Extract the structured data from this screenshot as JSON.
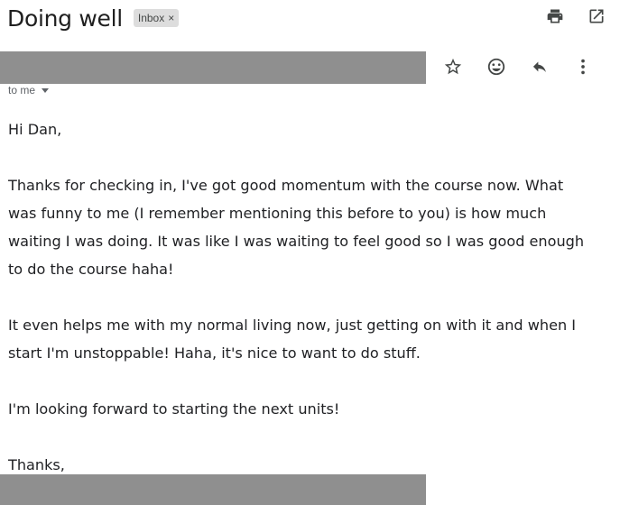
{
  "subject": "Doing well",
  "label": {
    "text": "Inbox",
    "remove_glyph": "×"
  },
  "top_icons": [
    "print-icon",
    "open-in-new-window-icon"
  ],
  "sender_icons": [
    "star-icon",
    "emoji-reaction-icon",
    "reply-icon",
    "more-options-icon"
  ],
  "recipient": {
    "text": "to me",
    "dropdown_icon": "caret-down-icon"
  },
  "body": {
    "greeting": "Hi Dan,",
    "paragraph_1": [
      "Thanks for checking in, I've got good momentum with the course now. What",
      "was funny to me (I remember mentioning this before to you) is how much",
      "waiting I was doing. It was like I was waiting to feel good so I was good enough",
      "to do the course haha!"
    ],
    "paragraph_2": [
      "It even helps me with my normal living now, just getting on with it and when I",
      "start I'm unstoppable! Haha, it's nice to want to do stuff."
    ],
    "paragraph_3": "I'm looking forward to starting the next units!",
    "closing": "Thanks,"
  },
  "colors": {
    "redaction": "#8f8f8f",
    "chip_bg": "#dddddd",
    "icon": "#444746"
  }
}
